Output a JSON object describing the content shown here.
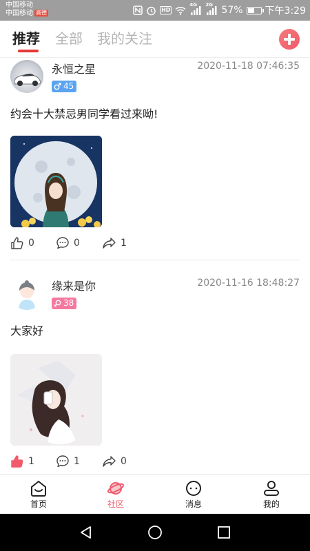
{
  "status_bar": {
    "carrier_line1": "中国移动",
    "carrier_line2": "中国移动",
    "carrier_badge": "高德",
    "battery": "57%",
    "time": "下午3:29",
    "net_label_1": "4G",
    "net_label_2": "2G",
    "hd": "HD",
    "battery_level": 0.57
  },
  "header": {
    "tabs": [
      {
        "label": "推荐",
        "active": true
      },
      {
        "label": "全部",
        "active": false
      },
      {
        "label": "我的关注",
        "active": false
      }
    ],
    "accent_color": "#e53935"
  },
  "posts": [
    {
      "username": "永恒之星",
      "timestamp": "2020-11-18 07:46:35",
      "gender": "male",
      "level": "45",
      "text": "约会十大禁忌男同学看过来呦!",
      "likes": "0",
      "comments": "0",
      "shares": "1",
      "avatar_icon": "sports-car-avatar",
      "image_icon": "moon-girl-illustration"
    },
    {
      "username": "缘来是你",
      "timestamp": "2020-11-16 18:48:27",
      "gender": "female",
      "level": "38",
      "text": "大家好",
      "likes": "1",
      "comments": "1",
      "shares": "0",
      "avatar_icon": "default-user-avatar",
      "image_icon": "girl-illustration"
    }
  ],
  "bottom_nav": {
    "items": [
      {
        "label": "首页",
        "icon": "home-icon",
        "active": false
      },
      {
        "label": "社区",
        "icon": "community-planet-icon",
        "active": true
      },
      {
        "label": "消息",
        "icon": "message-icon",
        "active": false
      },
      {
        "label": "我的",
        "icon": "profile-icon",
        "active": false
      }
    ],
    "active_color": "#ee5a6d"
  }
}
